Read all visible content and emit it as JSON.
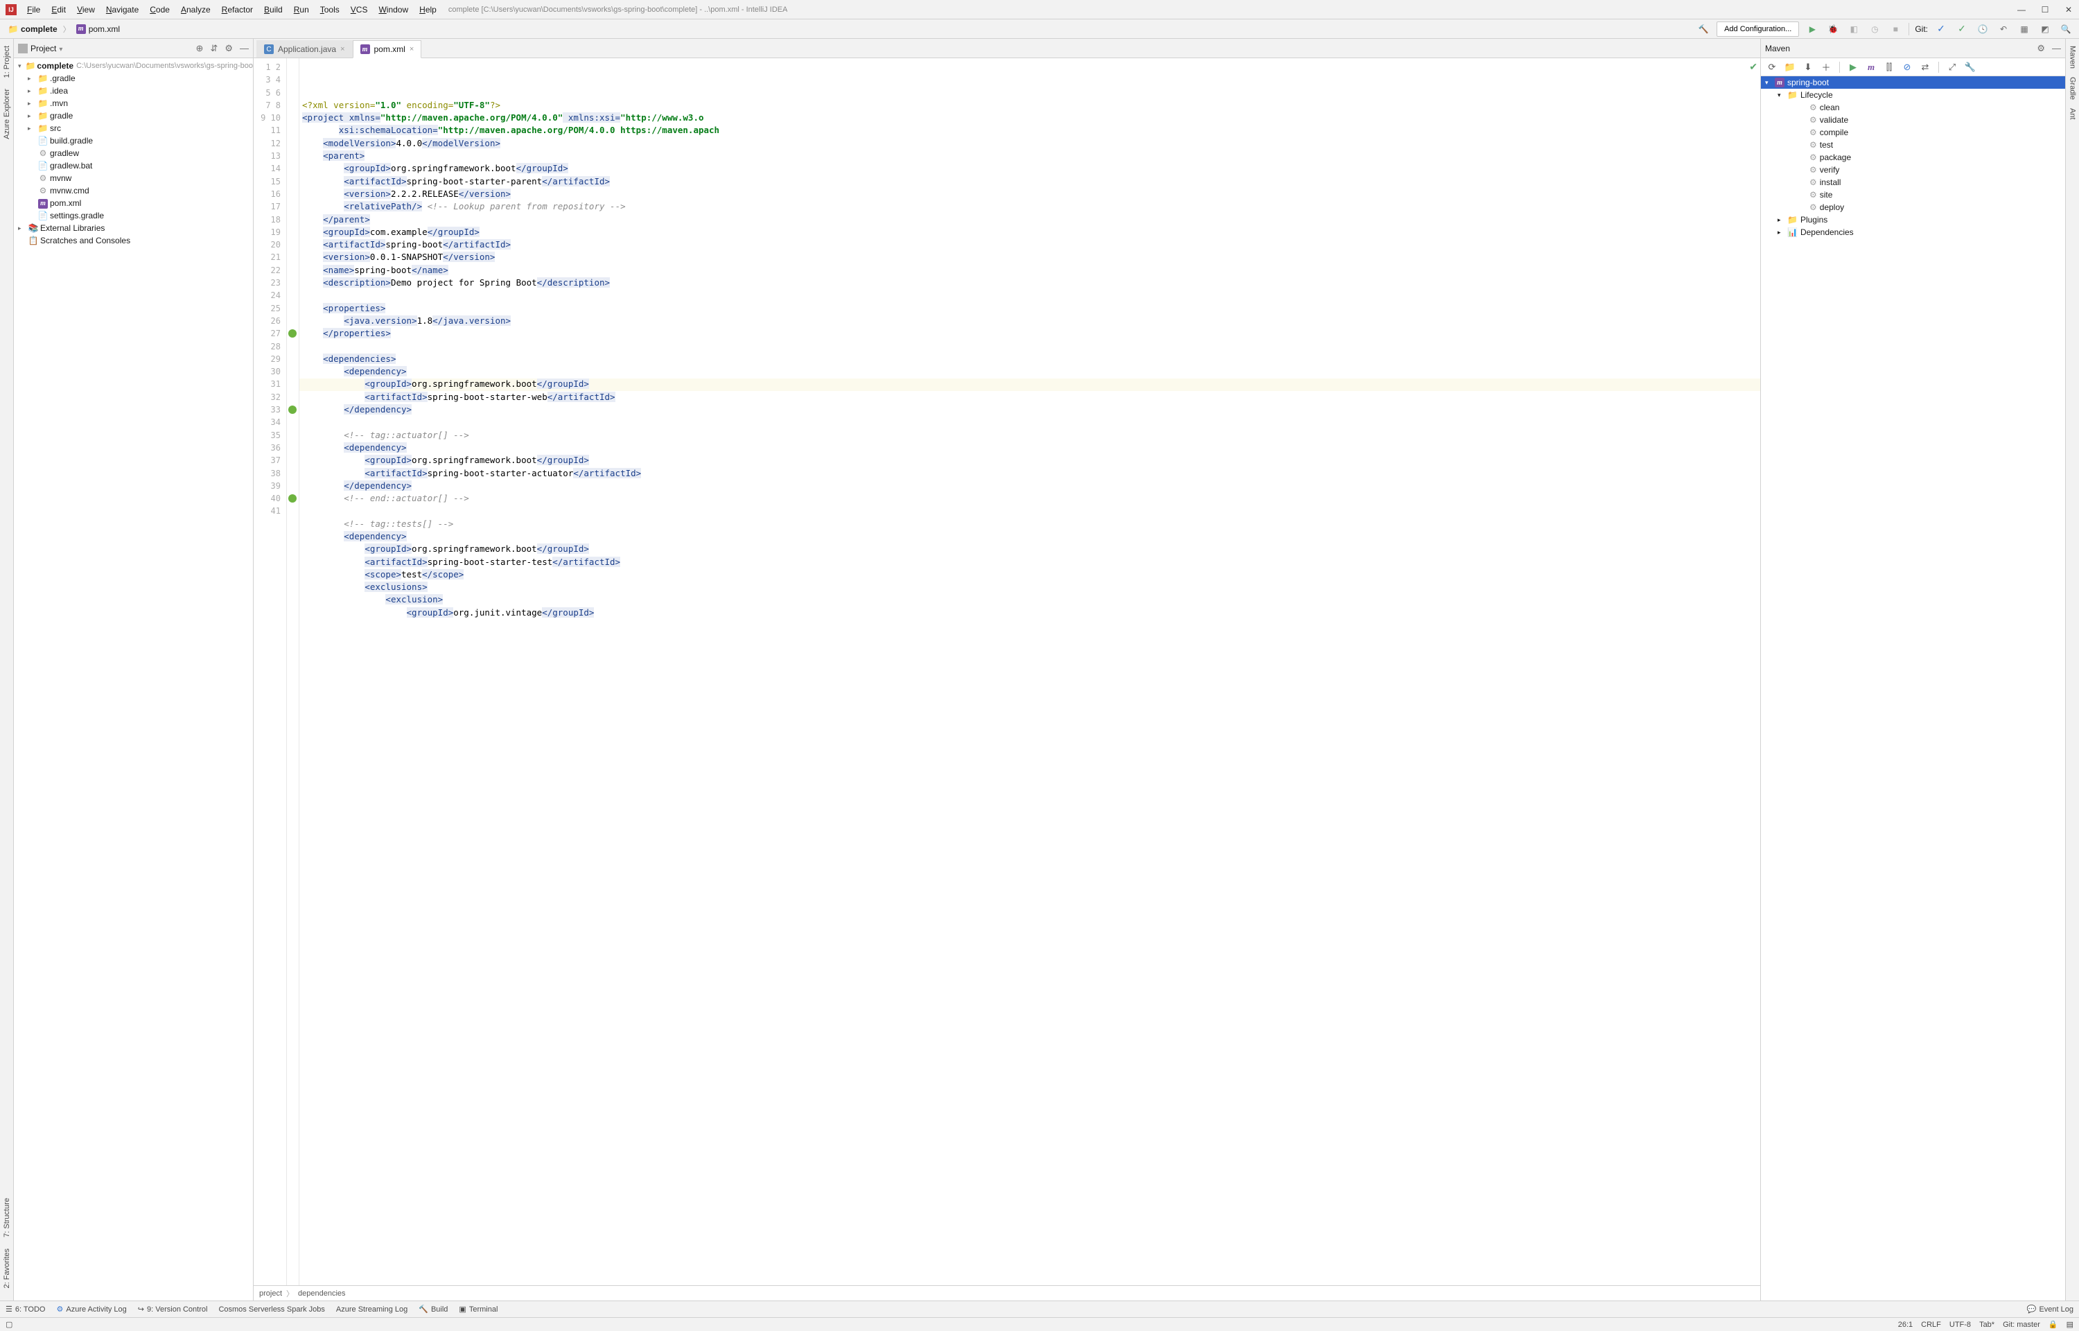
{
  "title_text": "complete [C:\\Users\\yucwan\\Documents\\vsworks\\gs-spring-boot\\complete] - ..\\pom.xml - IntelliJ IDEA",
  "menu": [
    "File",
    "Edit",
    "View",
    "Navigate",
    "Code",
    "Analyze",
    "Refactor",
    "Build",
    "Run",
    "Tools",
    "VCS",
    "Window",
    "Help"
  ],
  "breadcrumb": {
    "root": "complete",
    "file": "pom.xml"
  },
  "run_config": "Add Configuration...",
  "git_label": "Git:",
  "project": {
    "panel_title": "Project",
    "root_name": "complete",
    "root_path": "C:\\Users\\yucwan\\Documents\\vsworks\\gs-spring-boo",
    "folders": [
      "gradle",
      ".idea",
      ".mvn",
      "gradle",
      "src"
    ],
    "files": [
      "build.gradle",
      "gradlew",
      "gradlew.bat",
      "mvnw",
      "mvnw.cmd",
      "pom.xml",
      "settings.gradle"
    ],
    "ext_lib": "External Libraries",
    "scratch": "Scratches and Consoles",
    "dotfolder": ".gradle"
  },
  "tabs": [
    {
      "label": "Application.java",
      "type": "java"
    },
    {
      "label": "pom.xml",
      "type": "maven"
    }
  ],
  "editor_bc": [
    "project",
    "dependencies"
  ],
  "gutter_lines": 41,
  "code": [
    [
      [
        "decl",
        "<?"
      ],
      [
        "decl",
        "xml version="
      ],
      [
        "str",
        "\"1.0\""
      ],
      [
        "decl",
        " encoding="
      ],
      [
        "str",
        "\"UTF-8\""
      ],
      [
        "decl",
        "?>"
      ]
    ],
    [
      [
        "tag",
        "<project "
      ],
      [
        "attr",
        "xmlns="
      ],
      [
        "str",
        "\"http://maven.apache.org/POM/4.0.0\""
      ],
      [
        "attr",
        " xmlns:xsi="
      ],
      [
        "str",
        "\"http://www.w3.o"
      ]
    ],
    [
      [
        "txt",
        "       "
      ],
      [
        "attr",
        "xsi:schemaLocation="
      ],
      [
        "str",
        "\"http://maven.apache.org/POM/4.0.0 https://maven.apach"
      ]
    ],
    [
      [
        "txt",
        "    "
      ],
      [
        "tag",
        "<modelVersion>"
      ],
      [
        "txt",
        "4.0.0"
      ],
      [
        "tag",
        "</modelVersion>"
      ]
    ],
    [
      [
        "txt",
        "    "
      ],
      [
        "tag",
        "<parent>"
      ]
    ],
    [
      [
        "txt",
        "        "
      ],
      [
        "tag",
        "<groupId>"
      ],
      [
        "txt",
        "org.springframework.boot"
      ],
      [
        "tag",
        "</groupId>"
      ]
    ],
    [
      [
        "txt",
        "        "
      ],
      [
        "tag",
        "<artifactId>"
      ],
      [
        "txt",
        "spring-boot-starter-parent"
      ],
      [
        "tag",
        "</artifactId>"
      ]
    ],
    [
      [
        "txt",
        "        "
      ],
      [
        "tag",
        "<version>"
      ],
      [
        "txt",
        "2.2.2.RELEASE"
      ],
      [
        "tag",
        "</version>"
      ]
    ],
    [
      [
        "txt",
        "        "
      ],
      [
        "tag",
        "<relativePath/>"
      ],
      [
        "txt",
        " "
      ],
      [
        "cmt",
        "<!-- Lookup parent from repository -->"
      ]
    ],
    [
      [
        "txt",
        "    "
      ],
      [
        "tag",
        "</parent>"
      ]
    ],
    [
      [
        "txt",
        "    "
      ],
      [
        "tag",
        "<groupId>"
      ],
      [
        "txt",
        "com.example"
      ],
      [
        "tag",
        "</groupId>"
      ]
    ],
    [
      [
        "txt",
        "    "
      ],
      [
        "tag",
        "<artifactId>"
      ],
      [
        "txt",
        "spring-boot"
      ],
      [
        "tag",
        "</artifactId>"
      ]
    ],
    [
      [
        "txt",
        "    "
      ],
      [
        "tag",
        "<version>"
      ],
      [
        "txt",
        "0.0.1-SNAPSHOT"
      ],
      [
        "tag",
        "</version>"
      ]
    ],
    [
      [
        "txt",
        "    "
      ],
      [
        "tag",
        "<name>"
      ],
      [
        "txt",
        "spring-boot"
      ],
      [
        "tag",
        "</name>"
      ]
    ],
    [
      [
        "txt",
        "    "
      ],
      [
        "tag",
        "<description>"
      ],
      [
        "txt",
        "Demo project for Spring Boot"
      ],
      [
        "tag",
        "</description>"
      ]
    ],
    [
      [
        "txt",
        " "
      ]
    ],
    [
      [
        "txt",
        "    "
      ],
      [
        "tag",
        "<properties>"
      ]
    ],
    [
      [
        "txt",
        "        "
      ],
      [
        "tag",
        "<java.version>"
      ],
      [
        "txt",
        "1.8"
      ],
      [
        "tag",
        "</java.version>"
      ]
    ],
    [
      [
        "txt",
        "    "
      ],
      [
        "tag",
        "</properties>"
      ]
    ],
    [
      [
        "txt",
        " "
      ]
    ],
    [
      [
        "txt",
        "    "
      ],
      [
        "tag",
        "<dependencies>"
      ]
    ],
    [
      [
        "txt",
        "        "
      ],
      [
        "tag",
        "<dependency>"
      ]
    ],
    [
      [
        "txt",
        "            "
      ],
      [
        "tag",
        "<groupId>"
      ],
      [
        "txt",
        "org.springframework.boot"
      ],
      [
        "tag",
        "</groupId>"
      ]
    ],
    [
      [
        "txt",
        "            "
      ],
      [
        "tag",
        "<artifactId>"
      ],
      [
        "txt",
        "spring-boot-starter-web"
      ],
      [
        "tag",
        "</artifactId>"
      ]
    ],
    [
      [
        "txt",
        "        "
      ],
      [
        "tag",
        "</dependency>"
      ]
    ],
    [
      [
        "txt",
        " "
      ]
    ],
    [
      [
        "txt",
        "        "
      ],
      [
        "cmt",
        "<!-- tag::actuator[] -->"
      ]
    ],
    [
      [
        "txt",
        "        "
      ],
      [
        "tag",
        "<dependency>"
      ]
    ],
    [
      [
        "txt",
        "            "
      ],
      [
        "tag",
        "<groupId>"
      ],
      [
        "txt",
        "org.springframework.boot"
      ],
      [
        "tag",
        "</groupId>"
      ]
    ],
    [
      [
        "txt",
        "            "
      ],
      [
        "tag",
        "<artifactId>"
      ],
      [
        "txt",
        "spring-boot-starter-actuator"
      ],
      [
        "tag",
        "</artifactId>"
      ]
    ],
    [
      [
        "txt",
        "        "
      ],
      [
        "tag",
        "</dependency>"
      ]
    ],
    [
      [
        "txt",
        "        "
      ],
      [
        "cmt",
        "<!-- end::actuator[] -->"
      ]
    ],
    [
      [
        "txt",
        " "
      ]
    ],
    [
      [
        "txt",
        "        "
      ],
      [
        "cmt",
        "<!-- tag::tests[] -->"
      ]
    ],
    [
      [
        "txt",
        "        "
      ],
      [
        "tag",
        "<dependency>"
      ]
    ],
    [
      [
        "txt",
        "            "
      ],
      [
        "tag",
        "<groupId>"
      ],
      [
        "txt",
        "org.springframework.boot"
      ],
      [
        "tag",
        "</groupId>"
      ]
    ],
    [
      [
        "txt",
        "            "
      ],
      [
        "tag",
        "<artifactId>"
      ],
      [
        "txt",
        "spring-boot-starter-test"
      ],
      [
        "tag",
        "</artifactId>"
      ]
    ],
    [
      [
        "txt",
        "            "
      ],
      [
        "tag",
        "<scope>"
      ],
      [
        "txt",
        "test"
      ],
      [
        "tag",
        "</scope>"
      ]
    ],
    [
      [
        "txt",
        "            "
      ],
      [
        "tag",
        "<exclusions>"
      ]
    ],
    [
      [
        "txt",
        "                "
      ],
      [
        "tag",
        "<exclusion>"
      ]
    ],
    [
      [
        "txt",
        "                    "
      ],
      [
        "tag",
        "<groupId>"
      ],
      [
        "txt",
        "org.junit.vintage"
      ],
      [
        "tag",
        "</groupId>"
      ]
    ]
  ],
  "maven": {
    "panel_title": "Maven",
    "root": "spring-boot",
    "lifecycle_label": "Lifecycle",
    "lifecycle": [
      "clean",
      "validate",
      "compile",
      "test",
      "package",
      "verify",
      "install",
      "site",
      "deploy"
    ],
    "plugins": "Plugins",
    "deps": "Dependencies"
  },
  "leftstrip": {
    "project": "1: Project",
    "azure": "Azure Explorer",
    "structure": "7: Structure",
    "favorites": "2: Favorites"
  },
  "rightstrip": {
    "maven": "Maven",
    "gradle": "Gradle",
    "ant": "Ant"
  },
  "bottombar": {
    "todo": "6: TODO",
    "azure": "Azure Activity Log",
    "vcs": "9: Version Control",
    "cosmos": "Cosmos Serverless Spark Jobs",
    "stream": "Azure Streaming Log",
    "build": "Build",
    "terminal": "Terminal",
    "event": "Event Log"
  },
  "status": {
    "pos": "26:1",
    "sep": "CRLF",
    "enc": "UTF-8",
    "indent": "Tab*",
    "git": "Git: master"
  }
}
